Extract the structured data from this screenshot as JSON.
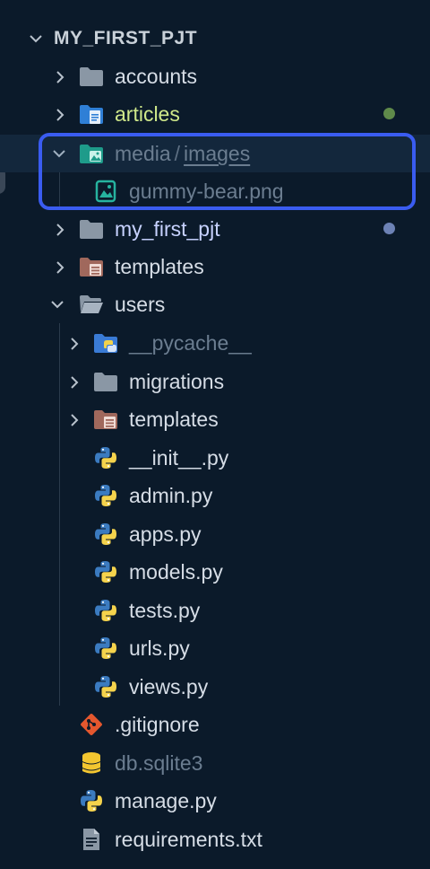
{
  "explorer": {
    "root": {
      "label": "MY_FIRST_PJT"
    },
    "items": [
      {
        "label": "accounts"
      },
      {
        "label": "articles"
      },
      {
        "label_media": "media",
        "label_sep": "/",
        "label_images": "images"
      },
      {
        "label": "gummy-bear.png"
      },
      {
        "label": "my_first_pjt"
      },
      {
        "label": "templates"
      },
      {
        "label": "users"
      },
      {
        "label": "__pycache__"
      },
      {
        "label": "migrations"
      },
      {
        "label": "templates"
      },
      {
        "label": "__init__.py"
      },
      {
        "label": "admin.py"
      },
      {
        "label": "apps.py"
      },
      {
        "label": "models.py"
      },
      {
        "label": "tests.py"
      },
      {
        "label": "urls.py"
      },
      {
        "label": "views.py"
      },
      {
        "label": ".gitignore"
      },
      {
        "label": "db.sqlite3"
      },
      {
        "label": "manage.py"
      },
      {
        "label": "requirements.txt"
      }
    ],
    "colors": {
      "background": "#0b1a2a",
      "selection": "#13273c",
      "highlight_border": "#3a5cf0",
      "modified_dot_green": "#5f8a4a",
      "modified_dot_blue": "#6d82b5"
    }
  }
}
